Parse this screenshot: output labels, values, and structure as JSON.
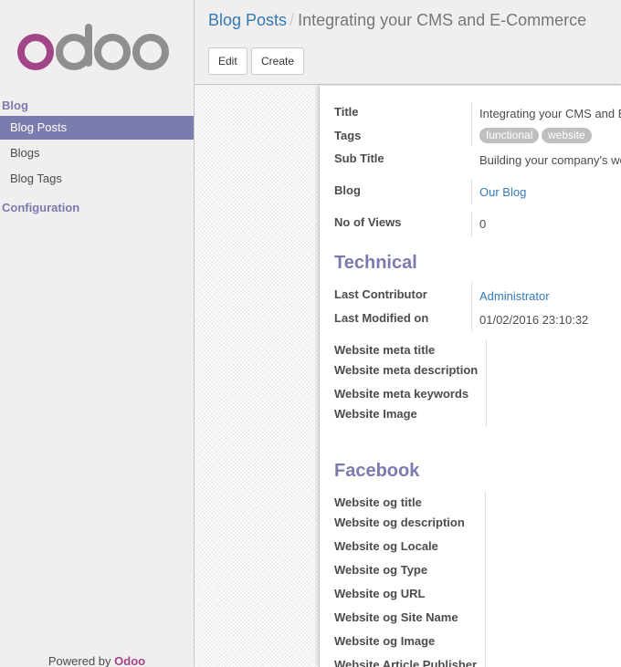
{
  "sidebar": {
    "logo_text": "odoo",
    "sections": [
      {
        "label": "Blog"
      },
      {
        "label": "Configuration"
      }
    ],
    "items": [
      {
        "label": "Blog Posts"
      },
      {
        "label": "Blogs"
      },
      {
        "label": "Blog Tags"
      }
    ],
    "powered_prefix": "Powered by",
    "powered_brand": "Odoo"
  },
  "breadcrumb": {
    "parent": "Blog Posts",
    "separator": "/",
    "current": "Integrating your CMS and E-Commerce"
  },
  "buttons": {
    "edit": "Edit",
    "create": "Create"
  },
  "form": {
    "title_label": "Title",
    "title_value": "Integrating your CMS and E-Commerce",
    "tags_label": "Tags",
    "tags": [
      "functional",
      "website"
    ],
    "subtitle_label": "Sub Title",
    "subtitle_value": "Building your company's website",
    "blog_label": "Blog",
    "blog_value": "Our Blog",
    "views_label": "No of Views",
    "views_value": "0"
  },
  "technical": {
    "title": "Technical",
    "contributor_label": "Last Contributor",
    "contributor_value": "Administrator",
    "modified_label": "Last Modified on",
    "modified_value": "01/02/2016 23:10:32",
    "meta_title_label": "Website meta title",
    "meta_desc_label": "Website meta description",
    "meta_keywords_label": "Website meta keywords",
    "image_label": "Website Image"
  },
  "facebook": {
    "title": "Facebook",
    "og_title_label": "Website og title",
    "og_desc_label": "Website og description",
    "og_locale_label": "Website og Locale",
    "og_type_label": "Website og Type",
    "og_url_label": "Website og URL",
    "og_site_label": "Website og Site Name",
    "og_image_label": "Website og Image",
    "article_pub_label": "Website Article Publisher"
  },
  "colors": {
    "brand_purple": "#7c7bad",
    "logo_purple": "#a24689",
    "logo_gray": "#8f8f8f",
    "link_blue": "#337ab7"
  }
}
